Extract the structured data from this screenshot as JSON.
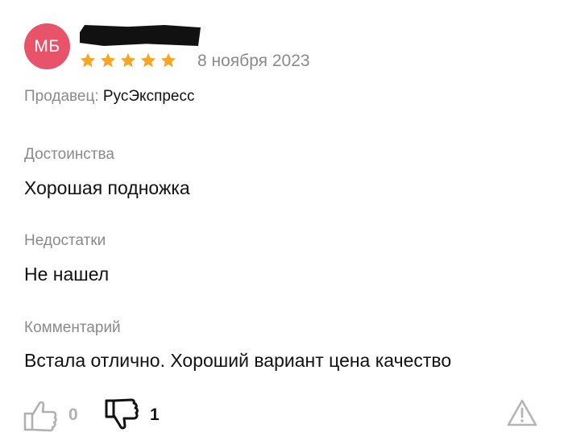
{
  "review": {
    "avatar_initials": "МБ",
    "avatar_color": "#e8536a",
    "rating": 5,
    "star_color": "#f5a623",
    "date": "8 ноября 2023",
    "seller_label": "Продавец:",
    "seller_name": "РусЭкспресс",
    "pros_title": "Достоинства",
    "pros_text": "Хорошая подножка",
    "cons_title": "Недостатки",
    "cons_text": "Не нашел",
    "comment_title": "Комментарий",
    "comment_text": "Встала отлично. Хороший вариант цена качество"
  },
  "votes": {
    "likes": "0",
    "dislikes": "1"
  },
  "icons": {
    "like": "thumbs-up-icon",
    "dislike": "thumbs-down-icon",
    "report": "warning-triangle-icon"
  }
}
